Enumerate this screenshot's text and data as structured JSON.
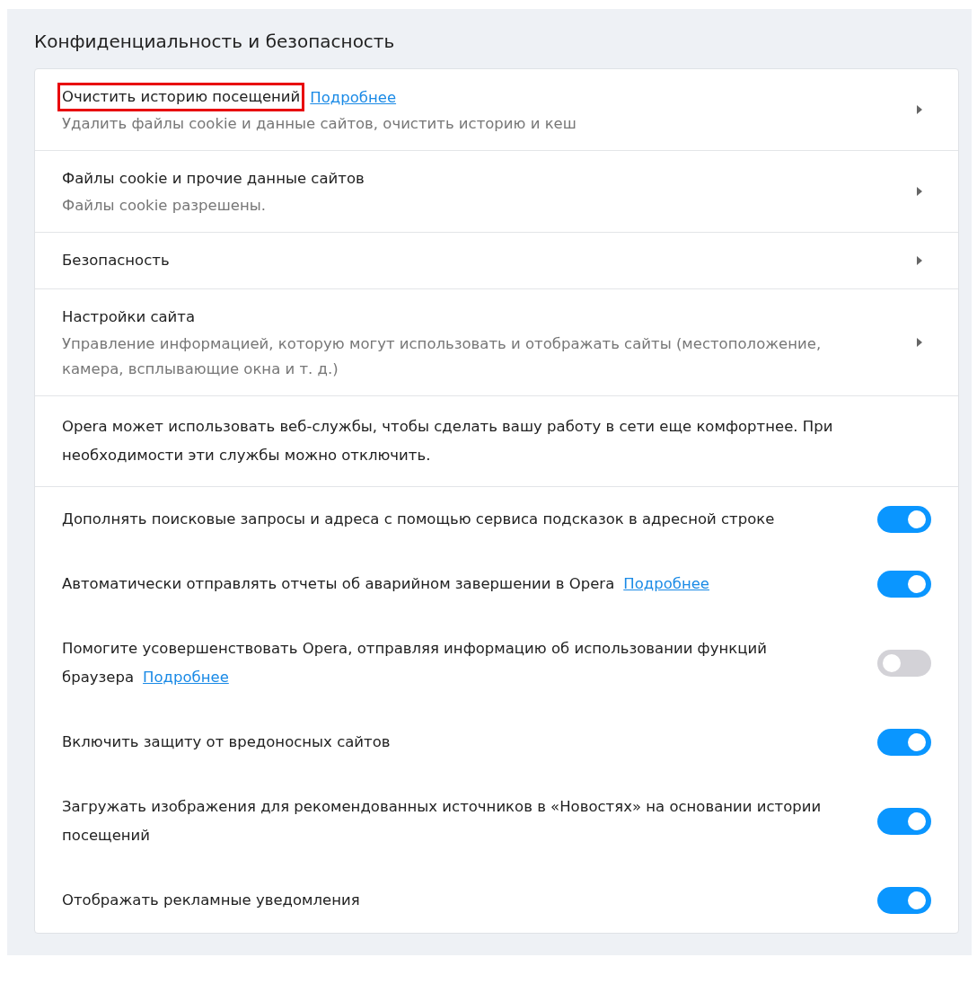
{
  "section_title": "Конфиденциальность и безопасность",
  "nav_rows": [
    {
      "title": "Очистить историю посещений",
      "highlighted": true,
      "link": "Подробнее",
      "subtitle": "Удалить файлы cookie и данные сайтов, очистить историю и кеш"
    },
    {
      "title": "Файлы cookie и прочие данные сайтов",
      "highlighted": false,
      "subtitle": "Файлы cookie разрешены."
    },
    {
      "title": "Безопасность",
      "highlighted": false
    },
    {
      "title": "Настройки сайта",
      "highlighted": false,
      "subtitle": "Управление информацией, которую могут использовать и отображать сайты (местоположение, камера, всплывающие окна и т. д.)"
    }
  ],
  "info_text": "Opera может использовать веб-службы, чтобы сделать вашу работу в сети еще комфортнее. При необходимости эти службы можно отключить.",
  "toggles": [
    {
      "label": "Дополнять поисковые запросы и адреса с помощью сервиса подсказок в адресной строке",
      "on": true
    },
    {
      "label": "Автоматически отправлять отчеты об аварийном завершении в Opera",
      "link": "Подробнее",
      "on": true
    },
    {
      "label": "Помогите усовершенствовать Opera, отправляя информацию об использовании функций браузера",
      "link": "Подробнее",
      "on": false
    },
    {
      "label": "Включить защиту от вредоносных сайтов",
      "on": true
    },
    {
      "label": "Загружать изображения для рекомендованных источников в «Новостях» на основании истории посещений",
      "on": true
    },
    {
      "label": "Отображать рекламные уведомления",
      "on": true
    }
  ]
}
